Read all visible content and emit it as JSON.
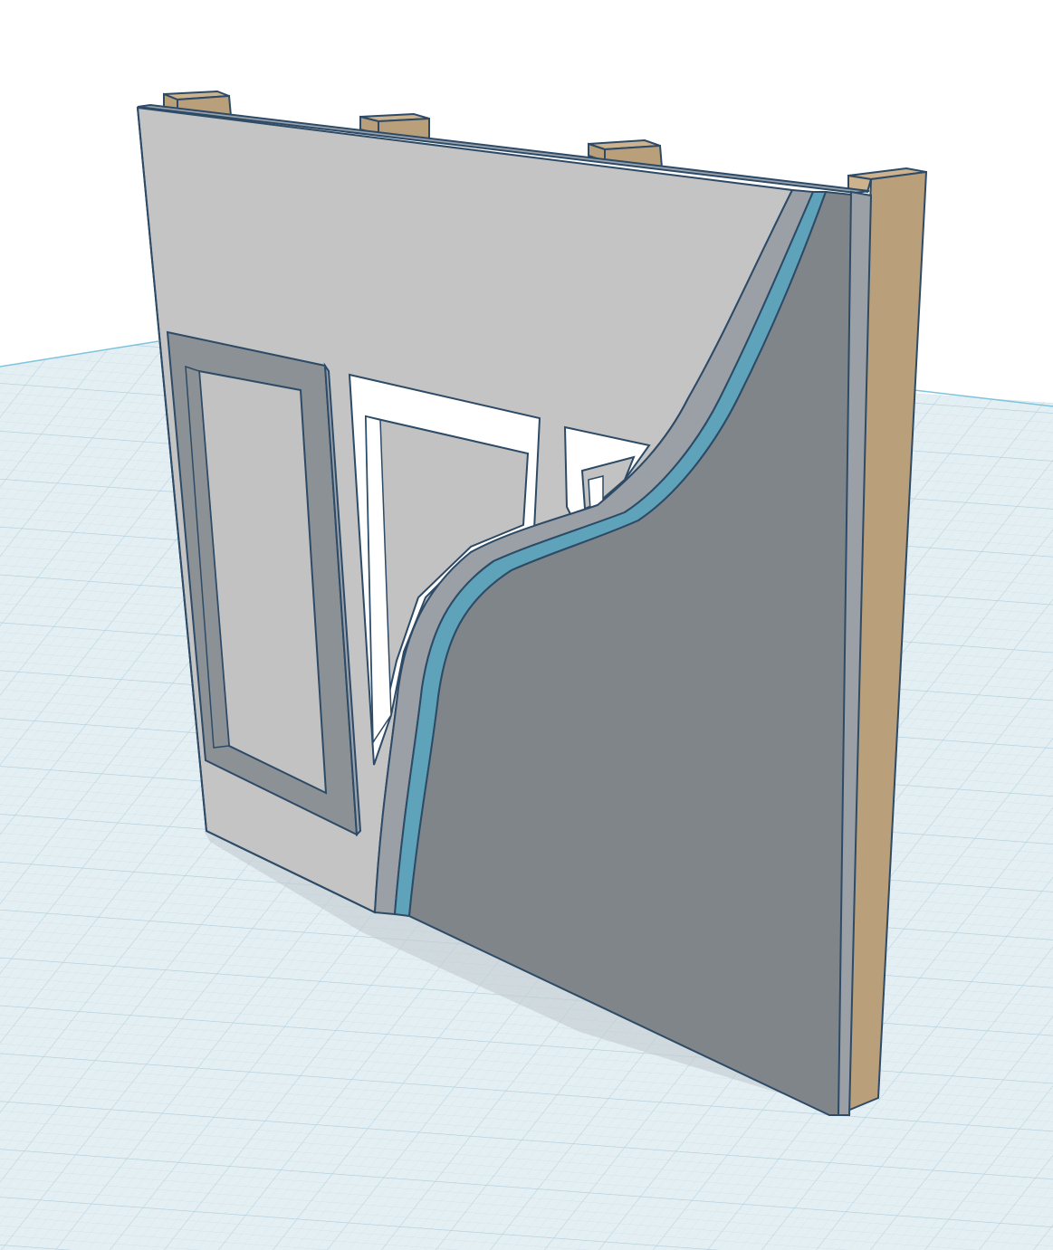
{
  "viewport": {
    "type": "3d-workplane",
    "colors": {
      "background": "#ffffff",
      "workplane": "#e4eff4",
      "grid_minor": "#cfe0e8",
      "grid_major": "#b3cfdc",
      "workplane_edge": "#7ec4dc"
    }
  },
  "model": {
    "name": "wall-cutaway",
    "colors": {
      "edge": "#2d4a66",
      "drywall_face": "#c4c4c4",
      "drywall_top": "#9aa3ab",
      "window_frame": "#8c9196",
      "window_glass": "#c2c2c2",
      "sheathing_face": "#808589",
      "sheathing_edge": "#9aa0a5",
      "insulation": "#5ea3b9",
      "stud": "#b99f7a",
      "stud_top": "#cdb28e",
      "shadow": "#c3cdd3"
    }
  }
}
